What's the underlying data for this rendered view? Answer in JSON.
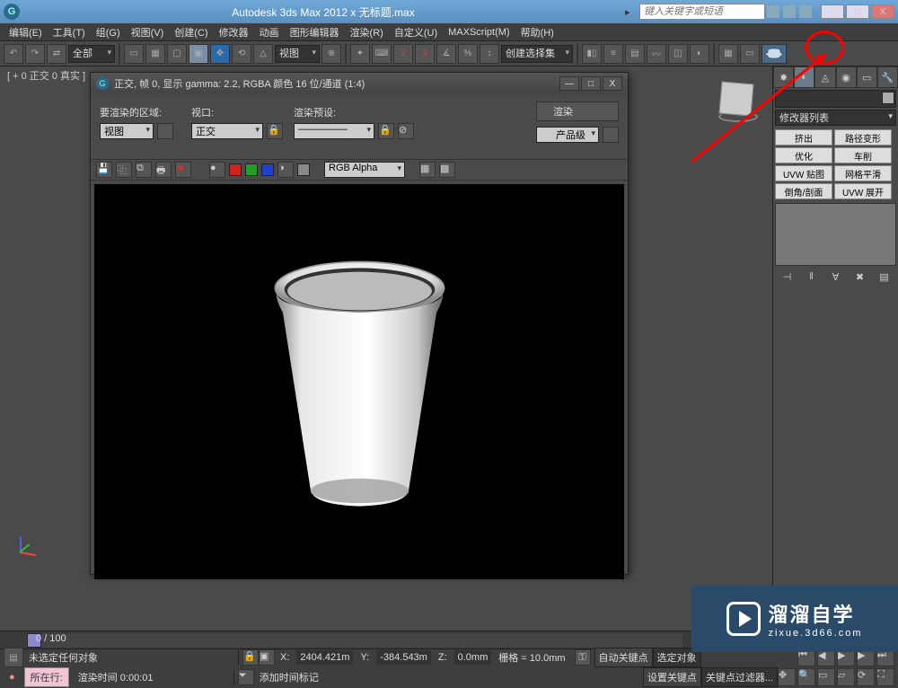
{
  "titlebar": {
    "app_glyph": "G",
    "title": "Autodesk 3ds Max 2012 x     无标题.max",
    "search_placeholder": "键入关键字或短语",
    "min": "—",
    "max": "□",
    "close": "X"
  },
  "menu": {
    "items": [
      "编辑(E)",
      "工具(T)",
      "组(G)",
      "视图(V)",
      "创建(C)",
      "修改器",
      "动画",
      "图形编辑器",
      "渲染(R)",
      "自定义(U)",
      "MAXScript(M)",
      "帮助(H)"
    ]
  },
  "toolbar": {
    "scope": "全部",
    "view_label": "视图",
    "angle": "3",
    "selection_set": "创建选择集"
  },
  "viewport": {
    "label": "[ + 0 正交 0 真实 ]"
  },
  "render_window": {
    "title": "正交, 帧 0, 显示 gamma: 2.2, RGBA 颜色 16 位/通道 (1:4)",
    "area_label": "要渲染的区域:",
    "area_value": "视图",
    "viewport_label": "视口:",
    "viewport_value": "正交",
    "preset_label": "渲染预设:",
    "preset_value": "—————",
    "render_btn": "渲染",
    "production": "产品级",
    "channel": "RGB Alpha",
    "min": "—",
    "max": "□",
    "close": "X"
  },
  "cmd_panel": {
    "modlist_label": "修改器列表",
    "buttons": [
      "挤出",
      "路径变形",
      "优化",
      "车削",
      "UVW 贴图",
      "网格平滑",
      "倒角/剖面",
      "UVW 展开"
    ]
  },
  "timeline": {
    "pos": "0 / 100"
  },
  "status": {
    "no_selection": "未选定任何对象",
    "location_label": "所在行:",
    "render_time_label": "渲染时间 0:00:01",
    "add_time_tag": "添加时间标记",
    "x_label": "X:",
    "x_val": "2404.421m",
    "y_label": "Y:",
    "y_val": "-384.543m",
    "z_label": "Z:",
    "z_val": "0.0mm",
    "grid_label": "栅格 = 10.0mm",
    "autokey": "自动关键点",
    "selected": "选定对象",
    "setkey": "设置关键点",
    "keyfilter": "关键点过滤器..."
  },
  "watermark": {
    "big": "溜溜自学",
    "small": "zixue.3d66.com"
  },
  "colors": {
    "swatch_red": "#d02020",
    "swatch_green": "#20a020",
    "swatch_blue": "#2040d0",
    "swatch_black": "#000000",
    "swatch_white": "#ffffff",
    "annot_red": "#ff0000"
  }
}
